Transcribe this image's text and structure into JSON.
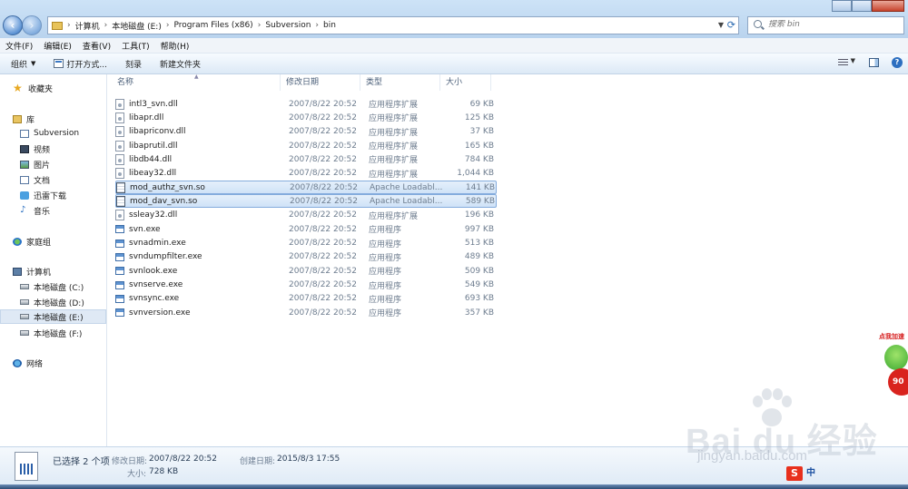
{
  "address": {
    "crumbs": [
      "计算机",
      "本地磁盘 (E:)",
      "Program Files (x86)",
      "Subversion",
      "bin"
    ]
  },
  "search": {
    "placeholder": "搜索 bin"
  },
  "menu": [
    "文件(F)",
    "编辑(E)",
    "查看(V)",
    "工具(T)",
    "帮助(H)"
  ],
  "toolbar": {
    "organize": "组织",
    "open": "打开方式...",
    "burn": "刻录",
    "new_folder": "新建文件夹"
  },
  "nav": {
    "favorites": "收藏夹",
    "libraries": "库",
    "lib_items": [
      "Subversion",
      "视频",
      "图片",
      "文档",
      "迅雷下载",
      "音乐"
    ],
    "homegroup": "家庭组",
    "computer": "计算机",
    "drives": [
      "本地磁盘 (C:)",
      "本地磁盘 (D:)",
      "本地磁盘 (E:)",
      "本地磁盘 (F:)"
    ],
    "network": "网络"
  },
  "columns": {
    "name": "名称",
    "modified": "修改日期",
    "type": "类型",
    "size": "大小"
  },
  "files": [
    {
      "name": "intl3_svn.dll",
      "date": "2007/8/22 20:52",
      "type": "应用程序扩展",
      "size": "69 KB",
      "icon": "dll-icon"
    },
    {
      "name": "libapr.dll",
      "date": "2007/8/22 20:52",
      "type": "应用程序扩展",
      "size": "125 KB",
      "icon": "dll-icon"
    },
    {
      "name": "libapriconv.dll",
      "date": "2007/8/22 20:52",
      "type": "应用程序扩展",
      "size": "37 KB",
      "icon": "dll-icon"
    },
    {
      "name": "libaprutil.dll",
      "date": "2007/8/22 20:52",
      "type": "应用程序扩展",
      "size": "165 KB",
      "icon": "dll-icon"
    },
    {
      "name": "libdb44.dll",
      "date": "2007/8/22 20:52",
      "type": "应用程序扩展",
      "size": "784 KB",
      "icon": "dll-icon"
    },
    {
      "name": "libeay32.dll",
      "date": "2007/8/22 20:52",
      "type": "应用程序扩展",
      "size": "1,044 KB",
      "icon": "dll-icon"
    },
    {
      "name": "mod_authz_svn.so",
      "date": "2007/8/22 20:52",
      "type": "Apache Loadabl...",
      "size": "141 KB",
      "icon": "so-icon"
    },
    {
      "name": "mod_dav_svn.so",
      "date": "2007/8/22 20:52",
      "type": "Apache Loadabl...",
      "size": "589 KB",
      "icon": "so-icon"
    },
    {
      "name": "ssleay32.dll",
      "date": "2007/8/22 20:52",
      "type": "应用程序扩展",
      "size": "196 KB",
      "icon": "dll-icon"
    },
    {
      "name": "svn.exe",
      "date": "2007/8/22 20:52",
      "type": "应用程序",
      "size": "997 KB",
      "icon": "exe-icon"
    },
    {
      "name": "svnadmin.exe",
      "date": "2007/8/22 20:52",
      "type": "应用程序",
      "size": "513 KB",
      "icon": "exe-icon"
    },
    {
      "name": "svndumpfilter.exe",
      "date": "2007/8/22 20:52",
      "type": "应用程序",
      "size": "489 KB",
      "icon": "exe-icon"
    },
    {
      "name": "svnlook.exe",
      "date": "2007/8/22 20:52",
      "type": "应用程序",
      "size": "509 KB",
      "icon": "exe-icon"
    },
    {
      "name": "svnserve.exe",
      "date": "2007/8/22 20:52",
      "type": "应用程序",
      "size": "549 KB",
      "icon": "exe-icon"
    },
    {
      "name": "svnsync.exe",
      "date": "2007/8/22 20:52",
      "type": "应用程序",
      "size": "693 KB",
      "icon": "exe-icon"
    },
    {
      "name": "svnversion.exe",
      "date": "2007/8/22 20:52",
      "type": "应用程序",
      "size": "357 KB",
      "icon": "exe-icon"
    }
  ],
  "selected_files": [
    "mod_authz_svn.so",
    "mod_dav_svn.so"
  ],
  "details": {
    "selection": "已选择 2 个项",
    "modified_label": "修改日期:",
    "modified_value": "2007/8/22 20:52",
    "created_label": "创建日期:",
    "created_value": "2015/8/3 17:55",
    "size_label": "大小:",
    "size_value": "728 KB"
  },
  "overlay": {
    "watermark": "Bai du 经验",
    "watermark_url": "jingyan.baidu.com",
    "accel_label": "点我加速",
    "accel_value": "90",
    "ime_s": "S",
    "ime_mode": "中"
  }
}
